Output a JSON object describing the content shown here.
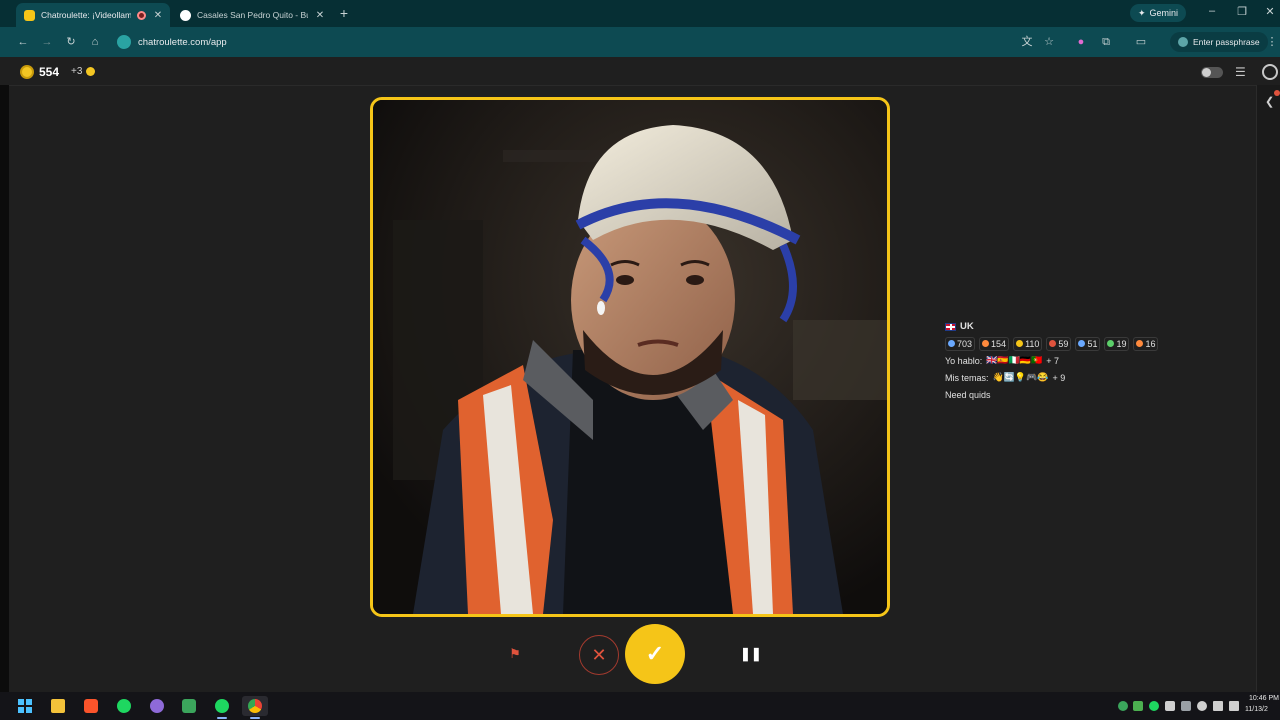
{
  "browser": {
    "tabs": [
      {
        "title": "Chatroulette: ¡Videollamada",
        "active": true
      },
      {
        "title": "Casales San Pedro Quito - Búsq",
        "active": false
      }
    ],
    "new_tab_label": "+",
    "gemini_label": "Gemini",
    "url": "chatroulette.com/app",
    "passphrase_label": "Enter passphrase",
    "window_controls": {
      "minimize": "–",
      "maximize": "❐",
      "close": "✕"
    }
  },
  "app": {
    "coins": "554",
    "coin_bonus": "+3",
    "accent_color": "#f5c518",
    "danger_color": "#e0533d"
  },
  "partner": {
    "country": "UK",
    "stats": [
      {
        "icon": "shield-icon",
        "value": "703",
        "color": "#6aa9ff"
      },
      {
        "icon": "heart-icon",
        "value": "154",
        "color": "#ff8a3d"
      },
      {
        "icon": "thumb-icon",
        "value": "110",
        "color": "#f5c518"
      },
      {
        "icon": "flag-icon",
        "value": "59",
        "color": "#e0533d"
      },
      {
        "icon": "star-icon",
        "value": "51",
        "color": "#6aa9ff"
      },
      {
        "icon": "leaf-icon",
        "value": "19",
        "color": "#5ccf6a"
      },
      {
        "icon": "gear-icon",
        "value": "16",
        "color": "#ff8a3d"
      }
    ],
    "languages_label": "Yo hablo:",
    "languages_flags": "🇬🇧🇪🇸🇮🇹🇩🇪🇵🇹",
    "languages_more": "+ 7",
    "topics_label": "Mis temas:",
    "topics_emojis": "👋🔄💡🎮😂",
    "topics_more": "+ 9",
    "bio": "Need quids"
  },
  "controls": {
    "report_icon": "⚑",
    "skip_icon": "✕",
    "accept_icon": "✓",
    "pause_icon": "❚❚"
  },
  "taskbar": {
    "clock_time": "10:46 PM",
    "clock_date": "11/13/2",
    "apps": [
      "windows-start",
      "file-explorer",
      "brave",
      "spotify",
      "chrome-profile",
      "discord",
      "spotify-2",
      "chrome"
    ]
  }
}
